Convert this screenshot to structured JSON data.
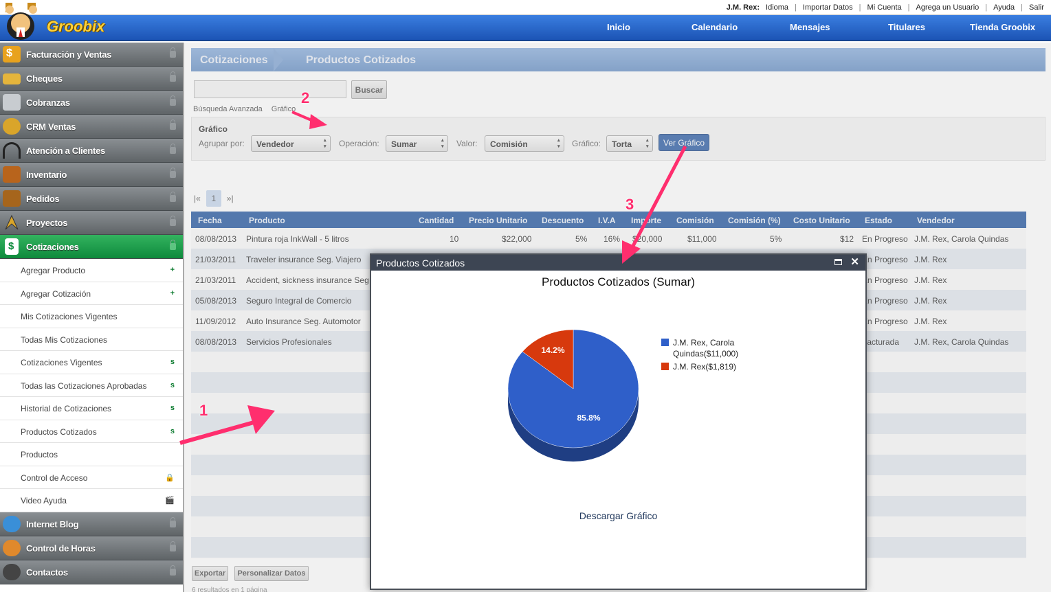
{
  "brand": {
    "name": "Groobix"
  },
  "topbar": {
    "user": "J.M. Rex:",
    "links": [
      "Idioma",
      "Importar Datos",
      "Mi Cuenta",
      "Agrega un Usuario",
      "Ayuda",
      "Salir"
    ]
  },
  "nav": {
    "items": [
      "Inicio",
      "Calendario",
      "Mensajes",
      "Titulares",
      "Tienda Groobix"
    ]
  },
  "sidebar": {
    "sections": [
      {
        "label": "Facturación y Ventas",
        "icon": "money-icon"
      },
      {
        "label": "Cheques",
        "icon": "cheque-icon"
      },
      {
        "label": "Cobranzas",
        "icon": "cash-register-icon"
      },
      {
        "label": "CRM Ventas",
        "icon": "coins-icon"
      },
      {
        "label": "Atención a Clientes",
        "icon": "headset-icon"
      },
      {
        "label": "Inventario",
        "icon": "boxes-icon"
      },
      {
        "label": "Pedidos",
        "icon": "box-icon"
      },
      {
        "label": "Proyectos",
        "icon": "compass-icon"
      },
      {
        "label": "Cotizaciones",
        "icon": "quote-icon"
      }
    ],
    "subitems": [
      {
        "label": "Agregar Producto",
        "mark": "+"
      },
      {
        "label": "Agregar Cotización",
        "mark": "+"
      },
      {
        "label": "Mis Cotizaciones Vigentes",
        "mark": ""
      },
      {
        "label": "Todas Mis Cotizaciones",
        "mark": ""
      },
      {
        "label": "Cotizaciones Vigentes",
        "mark": "s"
      },
      {
        "label": "Todas las Cotizaciones Aprobadas",
        "mark": "s"
      },
      {
        "label": "Historial de Cotizaciones",
        "mark": "s"
      },
      {
        "label": "Productos Cotizados",
        "mark": "s"
      },
      {
        "label": "Productos",
        "mark": ""
      },
      {
        "label": "Control de Acceso",
        "mark": ""
      },
      {
        "label": "Video Ayuda",
        "mark": ""
      }
    ],
    "bottom_sections": [
      {
        "label": "Internet Blog",
        "icon": "globe-icon"
      },
      {
        "label": "Control de Horas",
        "icon": "clock-icon"
      },
      {
        "label": "Contactos",
        "icon": "phone-icon"
      }
    ]
  },
  "breadcrumb": {
    "parent": "Cotizaciones",
    "current": "Productos Cotizados"
  },
  "search": {
    "button": "Buscar",
    "advanced": "Búsqueda Avanzada",
    "graph_link": "Gráfico"
  },
  "graph_panel": {
    "title": "Gráfico",
    "group_label": "Agrupar por:",
    "group_value": "Vendedor",
    "op_label": "Operación:",
    "op_value": "Sumar",
    "value_label": "Valor:",
    "value_value": "Comisión",
    "chart_label": "Gráfico:",
    "chart_value": "Torta",
    "button": "Ver Gráfico"
  },
  "pager": {
    "first": "|«",
    "page": "1",
    "last": "»|"
  },
  "table": {
    "headers": [
      "Fecha",
      "Producto",
      "Cantidad",
      "Precio Unitario",
      "Descuento",
      "I.V.A",
      "Importe",
      "Comisión",
      "Comisión (%)",
      "Costo Unitario",
      "Estado",
      "Vendedor"
    ],
    "rows": [
      [
        "08/08/2013",
        "Pintura roja InkWall - 5 litros",
        "10",
        "$22,000",
        "5%",
        "16%",
        "$20,000",
        "$11,000",
        "5%",
        "$12",
        "En Progreso",
        "J.M. Rex, Carola Quindas"
      ],
      [
        "21/03/2011",
        "Traveler insurance Seg. Viajero",
        "",
        "",
        "",
        "",
        "",
        "",
        "",
        "",
        "En Progreso",
        "J.M. Rex"
      ],
      [
        "21/03/2011",
        "Accident, sickness insurance Seg",
        "",
        "",
        "",
        "",
        "",
        "",
        "",
        "",
        "En Progreso",
        "J.M. Rex"
      ],
      [
        "05/08/2013",
        "Seguro Integral de Comercio",
        "",
        "",
        "",
        "",
        "",
        "",
        "",
        "",
        "En Progreso",
        "J.M. Rex"
      ],
      [
        "11/09/2012",
        "Auto Insurance Seg. Automotor",
        "",
        "",
        "",
        "",
        "",
        "",
        "",
        "",
        "En Progreso",
        "J.M. Rex"
      ],
      [
        "08/08/2013",
        "Servicios Profesionales",
        "",
        "",
        "",
        "",
        "",
        "",
        "",
        "",
        "Facturada",
        "J.M. Rex, Carola Quindas"
      ]
    ]
  },
  "footer_buttons": {
    "export": "Exportar",
    "custom": "Personalizar Datos",
    "results": "6 resultados en 1 página"
  },
  "modal": {
    "title": "Productos Cotizados",
    "chart_title": "Productos Cotizados (Sumar)",
    "download": "Descargar Gráfico"
  },
  "chart_data": {
    "type": "pie",
    "title": "Productos Cotizados (Sumar)",
    "slices": [
      {
        "label": "J.M. Rex, Carola Quindas($11,000)",
        "value": 11000,
        "percent": "85.8%",
        "color": "#2f5fc9"
      },
      {
        "label": "J.M. Rex($1,819)",
        "value": 1819,
        "percent": "14.2%",
        "color": "#d7390d"
      }
    ],
    "legend": "right"
  },
  "annotations": [
    "1",
    "2",
    "3"
  ],
  "colors": {
    "accent": "#2d5ea5",
    "active": "#16a14a",
    "annotation": "#ff2e6e"
  }
}
